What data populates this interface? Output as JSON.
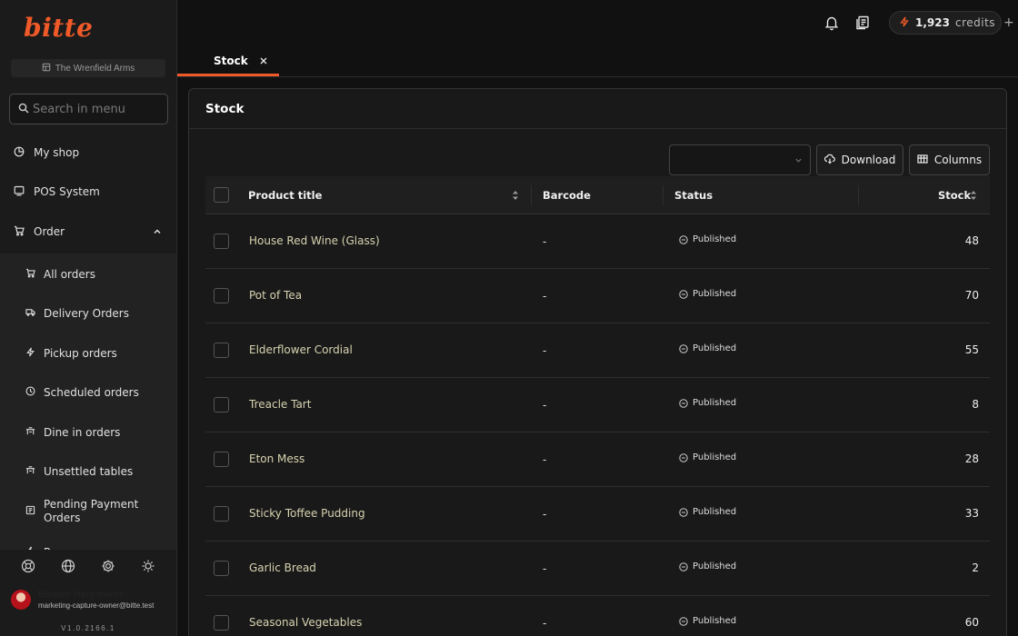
{
  "app": {
    "logo_text": "bitte",
    "venue": "The Wrenfield Arms",
    "accent_color": "#f05a28",
    "text_accent_color": "#d7d3b0"
  },
  "search": {
    "placeholder": "Search in menu"
  },
  "nav": {
    "items": [
      {
        "label": "My shop",
        "icon": "pie-chart-icon"
      },
      {
        "label": "POS System",
        "icon": "monitor-icon"
      },
      {
        "label": "Order",
        "icon": "cart-icon",
        "expanded": true
      }
    ],
    "order_children": [
      {
        "label": "All orders",
        "icon": "cart-icon"
      },
      {
        "label": "Delivery Orders",
        "icon": "truck-icon"
      },
      {
        "label": "Pickup orders",
        "icon": "bolt-icon"
      },
      {
        "label": "Scheduled orders",
        "icon": "clock-icon"
      },
      {
        "label": "Dine in orders",
        "icon": "dine-icon"
      },
      {
        "label": "Unsettled tables",
        "icon": "table-icon"
      },
      {
        "label": "Pending Payment Orders",
        "icon": "receipt-icon"
      }
    ],
    "partial_item": "Re"
  },
  "footer": {
    "icons": [
      "help-icon",
      "globe-icon",
      "settings-icon",
      "theme-icon"
    ],
    "user_name": "Eleanor Hargreaves",
    "user_email": "marketing-capture-owner@bitte.test",
    "version": "V1.0.2166.1"
  },
  "topbar": {
    "credits_count": "1,923",
    "credits_unit": "credits",
    "credits_plus": "+"
  },
  "tabs": [
    {
      "label": "Stock",
      "active": true
    }
  ],
  "panel": {
    "title": "Stock",
    "select_value": "",
    "download_label": "Download",
    "columns_label": "Columns"
  },
  "table": {
    "headers": {
      "product_title": "Product title",
      "barcode": "Barcode",
      "status": "Status",
      "stock": "Stock"
    },
    "rows": [
      {
        "title": "House Red Wine (Glass)",
        "barcode": "-",
        "status": "Published",
        "stock": "48"
      },
      {
        "title": "Pot of Tea",
        "barcode": "-",
        "status": "Published",
        "stock": "70"
      },
      {
        "title": "Elderflower Cordial",
        "barcode": "-",
        "status": "Published",
        "stock": "55"
      },
      {
        "title": "Treacle Tart",
        "barcode": "-",
        "status": "Published",
        "stock": "8"
      },
      {
        "title": "Eton Mess",
        "barcode": "-",
        "status": "Published",
        "stock": "28"
      },
      {
        "title": "Sticky Toffee Pudding",
        "barcode": "-",
        "status": "Published",
        "stock": "33"
      },
      {
        "title": "Garlic Bread",
        "barcode": "-",
        "status": "Published",
        "stock": "2"
      },
      {
        "title": "Seasonal Vegetables",
        "barcode": "-",
        "status": "Published",
        "stock": "60"
      }
    ]
  }
}
